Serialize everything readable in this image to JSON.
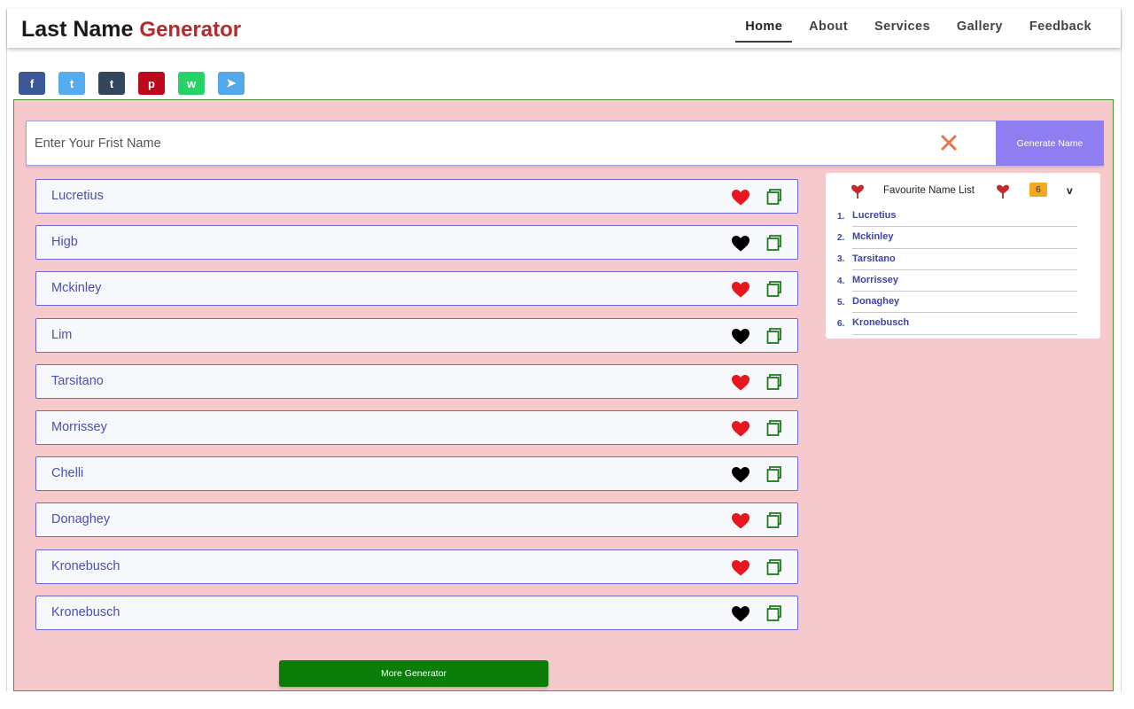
{
  "header": {
    "logo_main": "Last Name",
    "logo_accent": "Generator",
    "nav": [
      "Home",
      "About",
      "Services",
      "Gallery",
      "Feedback"
    ],
    "active_nav": "Home"
  },
  "social": [
    {
      "name": "facebook",
      "glyph": "f",
      "color": "#3b5998"
    },
    {
      "name": "twitter",
      "glyph": "t",
      "color": "#55acee"
    },
    {
      "name": "tumblr",
      "glyph": "t",
      "color": "#34465d"
    },
    {
      "name": "pinterest",
      "glyph": "p",
      "color": "#bd081c"
    },
    {
      "name": "whatsapp",
      "glyph": "w",
      "color": "#25d366"
    },
    {
      "name": "telegram",
      "glyph": "➤",
      "color": "#54a9eb"
    }
  ],
  "search": {
    "placeholder": "Enter Your Frist Name",
    "value": "",
    "generate_label": "Generate Name",
    "clear_icon": "close-icon"
  },
  "names": [
    {
      "name": "Lucretius",
      "favorite": true
    },
    {
      "name": "Higb",
      "favorite": false
    },
    {
      "name": "Mckinley",
      "favorite": true
    },
    {
      "name": "Lim",
      "favorite": false
    },
    {
      "name": "Tarsitano",
      "favorite": true
    },
    {
      "name": "Morrissey",
      "favorite": true
    },
    {
      "name": "Chelli",
      "favorite": false
    },
    {
      "name": "Donaghey",
      "favorite": true
    },
    {
      "name": "Kronebusch",
      "favorite": true
    },
    {
      "name": "Kronebusch",
      "favorite": false
    }
  ],
  "favorites": {
    "title": "Favourite Name List",
    "count": "6",
    "toggle": "v",
    "items": [
      "Lucretius",
      "Mckinley",
      "Tarsitano",
      "Morrissey",
      "Donaghey",
      "Kronebusch"
    ]
  },
  "more_label": "More Generator",
  "colors": {
    "panel_bg": "#f6c9cc",
    "heart_fav": "#e8161d",
    "heart_not": "#000000",
    "copy_icon": "#1f7a1f",
    "generate_bg": "#8f7ef2",
    "more_bg": "#0a7d09"
  }
}
